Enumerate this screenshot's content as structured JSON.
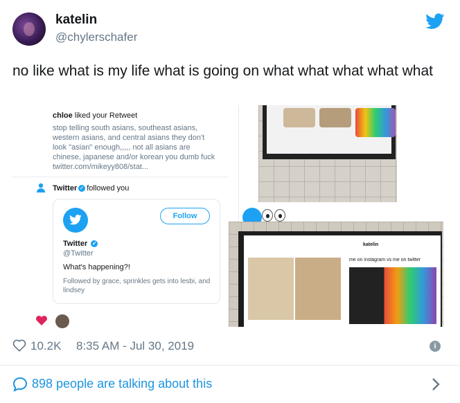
{
  "author": {
    "display_name": "katelin",
    "handle": "@chylerschafer"
  },
  "tweet": {
    "text": "no like what is my life what is going on what what what what what"
  },
  "media": {
    "notification": {
      "who": "chloe",
      "action": "liked your Retweet",
      "body": "stop telling south asians, southeast asians, western asians, and central asians they don't look \"asian\" enough,,,,, not all asians are chinese, japanese and/or korean you dumb fuck twitter.com/mikeyy808/stat..."
    },
    "follow_notice": {
      "account": "Twitter",
      "action": "followed you"
    },
    "profile_card": {
      "name": "Twitter",
      "handle": "@Twitter",
      "bio": "What's happening?!",
      "followed_by": "Followed by grace, sprinkles gets into lesbi, and lindsey",
      "follow_label": "Follow"
    },
    "photo_bottom": {
      "screen_name": "katelin",
      "caption": "me on instagram vs me on twitter"
    }
  },
  "footer": {
    "likes": "10.2K",
    "timestamp": "8:35 AM - Jul 30, 2019",
    "talking": "898 people are talking about this"
  },
  "colors": {
    "brand": "#1da1f2",
    "link": "#1b95e0",
    "muted": "#657786",
    "text": "#14171a",
    "heart": "#e0245e"
  }
}
